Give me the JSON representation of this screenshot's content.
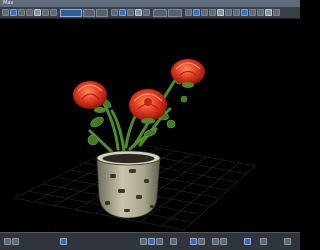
{
  "window": {
    "title": "Max"
  },
  "toolbar": {
    "icons": [
      "select-icon",
      "move-icon",
      "rotate-icon",
      "scale-icon",
      "link-icon",
      "unlink-icon",
      "bind-icon",
      "filter-icon",
      "select-region-icon",
      "window-icon",
      "undo-icon",
      "redo-icon",
      "snap-icon",
      "angle-snap-icon",
      "percent-snap-icon",
      "spinner-snap-icon",
      "mirror-icon",
      "align-icon",
      "layers-icon",
      "curve-editor-icon",
      "schematic-icon",
      "material-editor-icon",
      "render-setup-icon",
      "render-icon"
    ],
    "tabs": [
      "tab-1",
      "tab-2",
      "tab-3",
      "tab-4",
      "tab-5"
    ]
  },
  "statusbar": {
    "icons": [
      "lock-icon",
      "absolute-mode-icon",
      "key-mode-icon",
      "prev-frame-icon",
      "play-icon",
      "next-frame-icon",
      "time-config-icon",
      "zoom-icon",
      "zoom-all-icon",
      "zoom-extents-icon",
      "fov-icon",
      "pan-icon",
      "orbit-icon",
      "maximize-icon"
    ]
  },
  "colors": {
    "background": "#000000",
    "grid": "#2a2a2a",
    "flower": "#d9321f",
    "stem": "#4f8a2c",
    "vase": "#b9b59c"
  }
}
